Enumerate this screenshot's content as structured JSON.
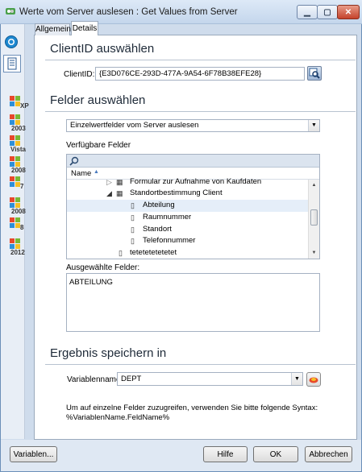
{
  "window": {
    "title": "Werte vom Server auslesen : Get Values from Server"
  },
  "sidebar": {
    "os_items": [
      {
        "label": "XP"
      },
      {
        "label": "2003"
      },
      {
        "label": "Vista"
      },
      {
        "label": "2008"
      },
      {
        "label": "7"
      },
      {
        "label": "2008"
      },
      {
        "label": "8"
      },
      {
        "label": "2012"
      }
    ]
  },
  "tabs": {
    "general": "Allgemein",
    "details": "Details"
  },
  "client_section": {
    "title": "ClientID auswählen",
    "clientid_label": "ClientID:",
    "clientid_value": "{E3D076CE-293D-477A-9A54-6F78B38EFE28}"
  },
  "fields_section": {
    "title": "Felder auswählen",
    "mode_value": "Einzelwertfelder vom Server auslesen",
    "available_label": "Verfügbare Felder",
    "column_name": "Name",
    "tree_items": [
      {
        "label": "Formular zur Aufnahme von Kaufdaten"
      },
      {
        "label": "Standortbestimmung Client"
      },
      {
        "label": "Abteilung"
      },
      {
        "label": "Raumnummer"
      },
      {
        "label": "Standort"
      },
      {
        "label": "Telefonnummer"
      },
      {
        "label": "tetetetetetetet"
      }
    ],
    "selected_label": "Ausgewählte Felder:",
    "selected_value": "ABTEILUNG"
  },
  "result_section": {
    "title": "Ergebnis speichern in",
    "varname_label": "Variablenname:",
    "varname_value": "DEPT",
    "hint_line1": "Um auf einzelne Felder zuzugreifen, verwenden Sie bitte folgende Syntax:",
    "hint_line2": "%VariablenName.FeldName%"
  },
  "footer": {
    "variables_button": "Variablen...",
    "help_button": "Hilfe",
    "ok_button": "OK",
    "cancel_button": "Abbrechen"
  },
  "colors": {
    "selected_row": "#e5eef9",
    "accent_blue": "#1e6fb8"
  }
}
